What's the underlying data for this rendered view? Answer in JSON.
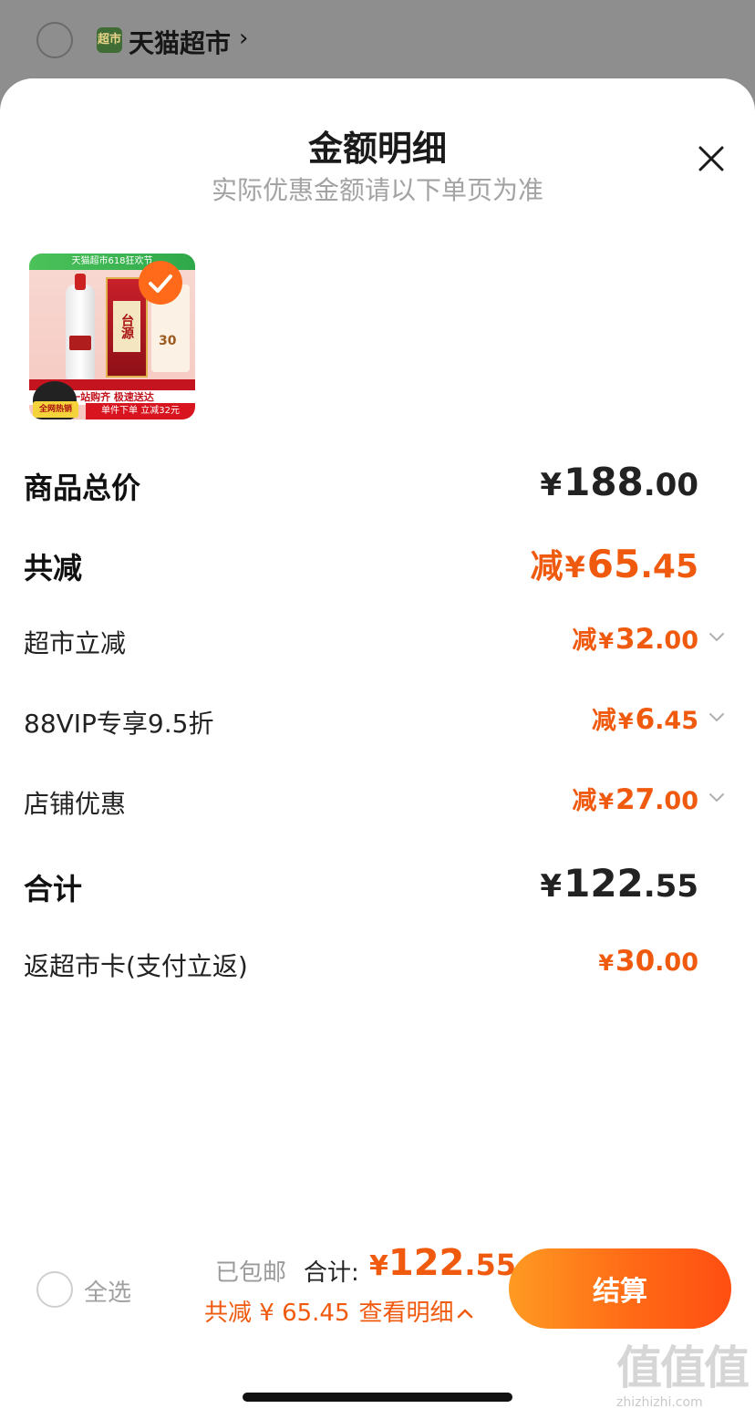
{
  "store": {
    "logo_text": "超市",
    "name": "天猫超市"
  },
  "sheet": {
    "title": "金额明细",
    "subtitle": "实际优惠金额请以下单页为准"
  },
  "product": {
    "banner": "天猫超市618狂欢节",
    "box_label": "台源",
    "info_number": "30",
    "strip_text": "一站购齐 极速送达",
    "promo_text": "单件下单 立减32元",
    "badge": "全网热销"
  },
  "rows": {
    "goods_total": {
      "label": "商品总价",
      "yen": "¥",
      "int": "188",
      "dec": ".00"
    },
    "total_discount": {
      "label": "共减",
      "prefix": "减",
      "yen": "¥",
      "int": "65",
      "dec": ".45"
    },
    "supermarket_off": {
      "label": "超市立减",
      "prefix": "减",
      "yen": "¥",
      "int": "32",
      "dec": ".00"
    },
    "vip": {
      "label": "88VIP专享9.5折",
      "prefix": "减",
      "yen": "¥",
      "int": "6",
      "dec": ".45"
    },
    "store_promo": {
      "label": "店铺优惠",
      "prefix": "减",
      "yen": "¥",
      "int": "27",
      "dec": ".00"
    },
    "total": {
      "label": "合计",
      "yen": "¥",
      "int": "122",
      "dec": ".55"
    },
    "card_rebate": {
      "label": "返超市卡(支付立返)",
      "yen": "¥",
      "int": "30",
      "dec": ".00"
    }
  },
  "bottom": {
    "select_all": "全选",
    "shipping": "已包邮",
    "total_label": "合计:",
    "total_yen": "¥",
    "total_int": "122",
    "total_dec": ".55",
    "discount_text": "共减 ¥ 65.45",
    "detail_link": "查看明细",
    "checkout": "结算"
  },
  "watermark": {
    "glyphs": "值值值",
    "url": "zhizhizhi.com"
  },
  "colors": {
    "accent": "#f05a0f",
    "checkout_gradient_start": "#ff9a22",
    "checkout_gradient_end": "#ff4e12",
    "overlay": "#8e8e8e"
  },
  "icons": [
    "close-icon",
    "chevron-down-icon",
    "chevron-right-icon",
    "chevron-up-icon",
    "check-icon"
  ]
}
